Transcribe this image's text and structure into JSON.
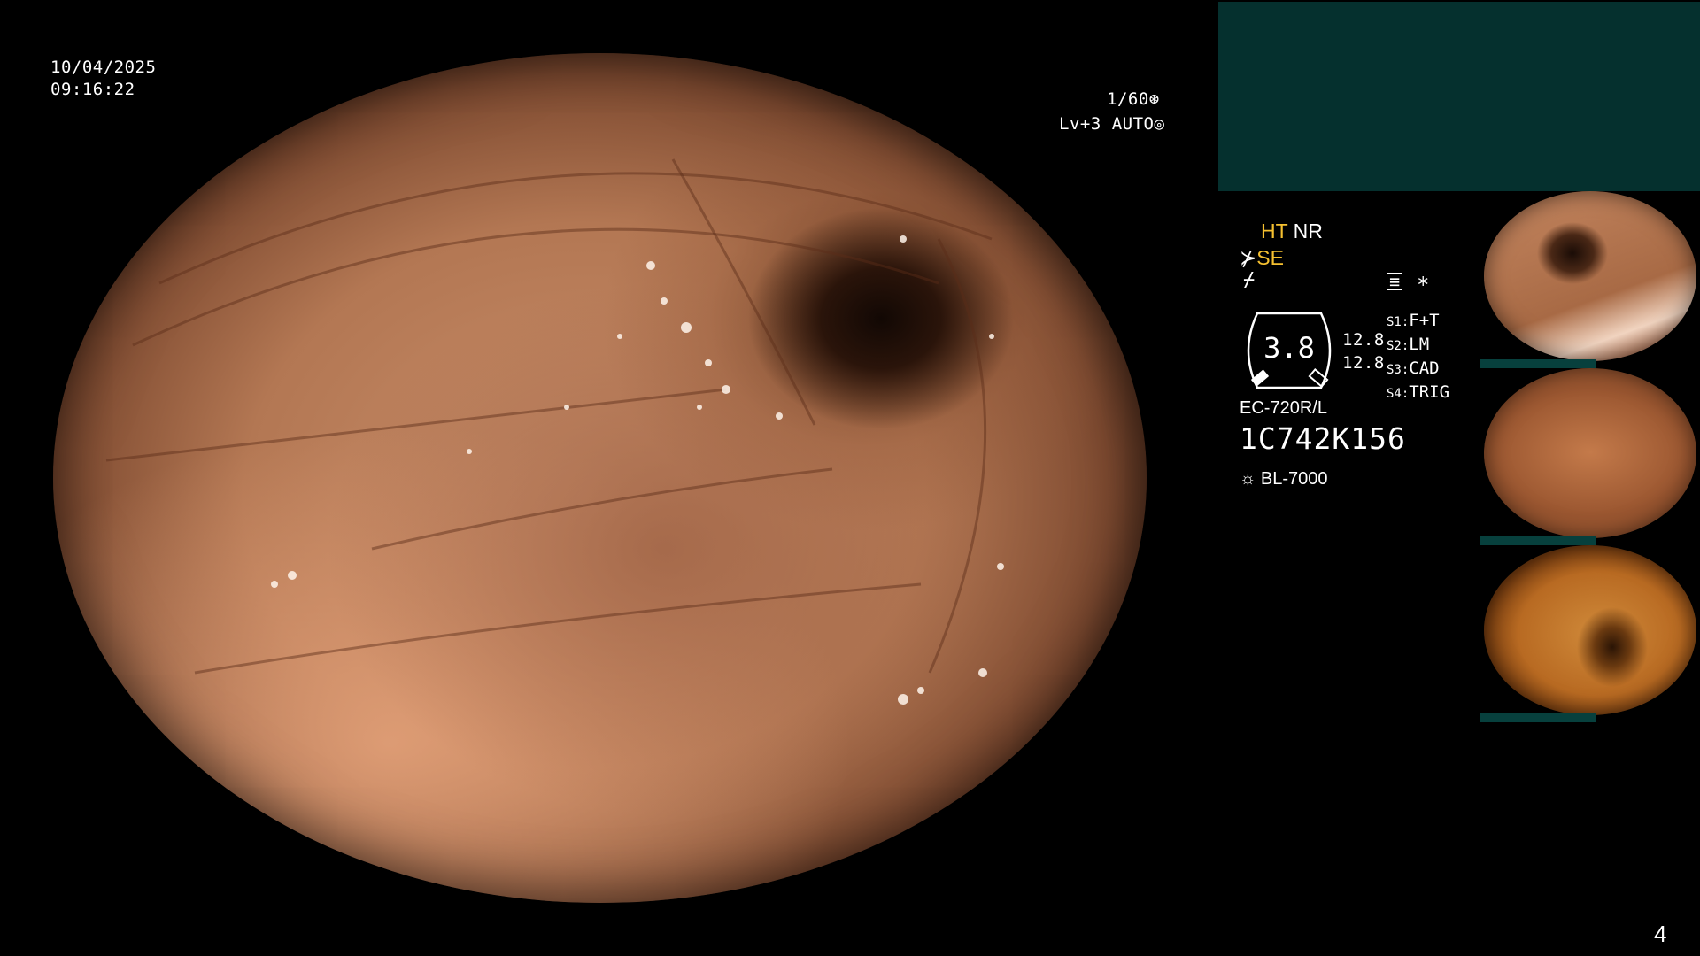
{
  "header": {
    "date": "10/04/2025",
    "time": "09:16:22"
  },
  "exposure": {
    "shutter": "1/60",
    "level": "Lv+3",
    "mode": "AUTO"
  },
  "settings": {
    "ht": "HT",
    "nr": "NR",
    "se": "SE",
    "zoom_value": "3.8",
    "num_1": "12.8",
    "num_2": "12.8",
    "s_labels": [
      "S1:",
      "S2:",
      "S3:",
      "S4:"
    ],
    "s_values": [
      "F+T",
      "LM",
      "CAD",
      "TRIG"
    ],
    "asterisk": "*"
  },
  "device": {
    "scope_model": "EC-720R/L",
    "serial": "1C742K156",
    "light_source": "BL-7000"
  },
  "page_number": "4",
  "thumbnails": [
    {
      "name": "thumbnail-1"
    },
    {
      "name": "thumbnail-2"
    },
    {
      "name": "thumbnail-3"
    }
  ],
  "colors": {
    "accent_yellow": "#f5c030",
    "panel_teal": "#05302e"
  }
}
